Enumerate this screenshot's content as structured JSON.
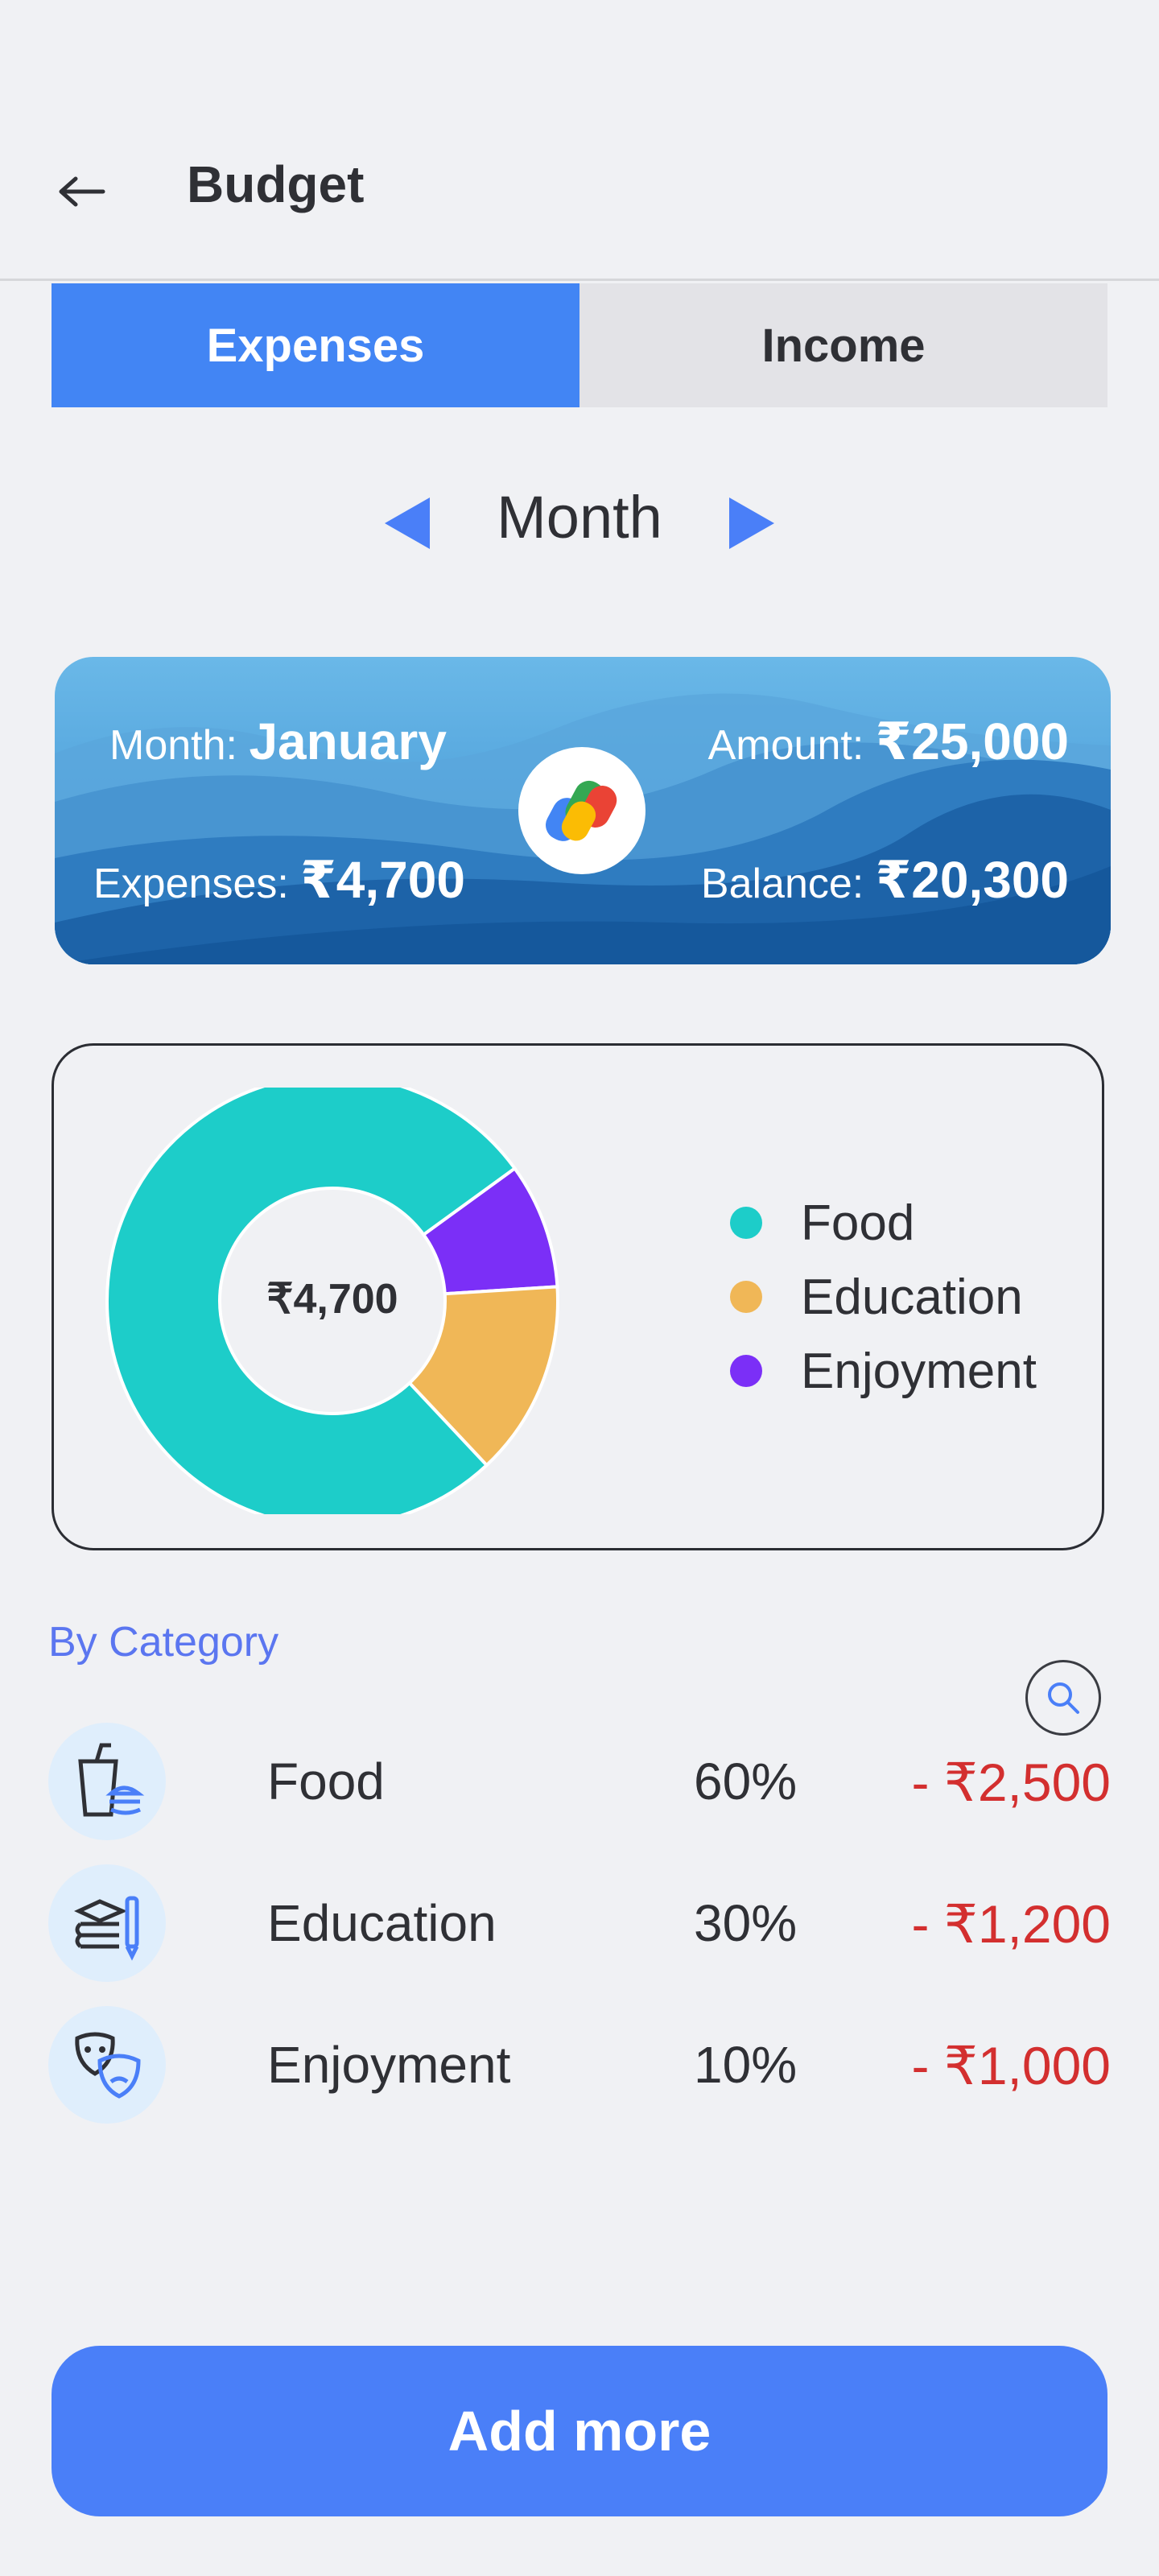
{
  "header": {
    "title": "Budget",
    "back_icon": "arrow-left-icon"
  },
  "tabs": [
    {
      "label": "Expenses",
      "active": true
    },
    {
      "label": "Income",
      "active": false
    }
  ],
  "period": {
    "label": "Month",
    "prev_icon": "triangle-left-icon",
    "next_icon": "triangle-right-icon"
  },
  "summary": {
    "month_label": "Month:",
    "month_value": "January",
    "amount_label": "Amount:",
    "amount_value": "₹25,000",
    "expenses_label": "Expenses:",
    "expenses_value": "₹4,700",
    "balance_label": "Balance:",
    "balance_value": "₹20,300",
    "logo_icon": "google-pay-logo-icon"
  },
  "chart_data": {
    "type": "pie",
    "center_label": "₹4,700",
    "categories": [
      "Food",
      "Education",
      "Enjoyment"
    ],
    "values": [
      77,
      14,
      9
    ],
    "colors": [
      "#1dcdc9",
      "#f0b757",
      "#7b2ff7"
    ],
    "legend_position": "right"
  },
  "category_section": {
    "title": "By Category",
    "search_icon": "search-icon"
  },
  "categories": [
    {
      "name": "Food",
      "percent": "60%",
      "amount": "- ₹2,500",
      "icon": "food-drink-icon"
    },
    {
      "name": "Education",
      "percent": "30%",
      "amount": "- ₹1,200",
      "icon": "books-icon"
    },
    {
      "name": "Enjoyment",
      "percent": "10%",
      "amount": "- ₹1,000",
      "icon": "theater-masks-icon"
    }
  ],
  "actions": {
    "add_more_label": "Add more"
  },
  "colors": {
    "primary": "#4285f4",
    "negative": "#d32f2f",
    "accent_text": "#5b76f0"
  }
}
